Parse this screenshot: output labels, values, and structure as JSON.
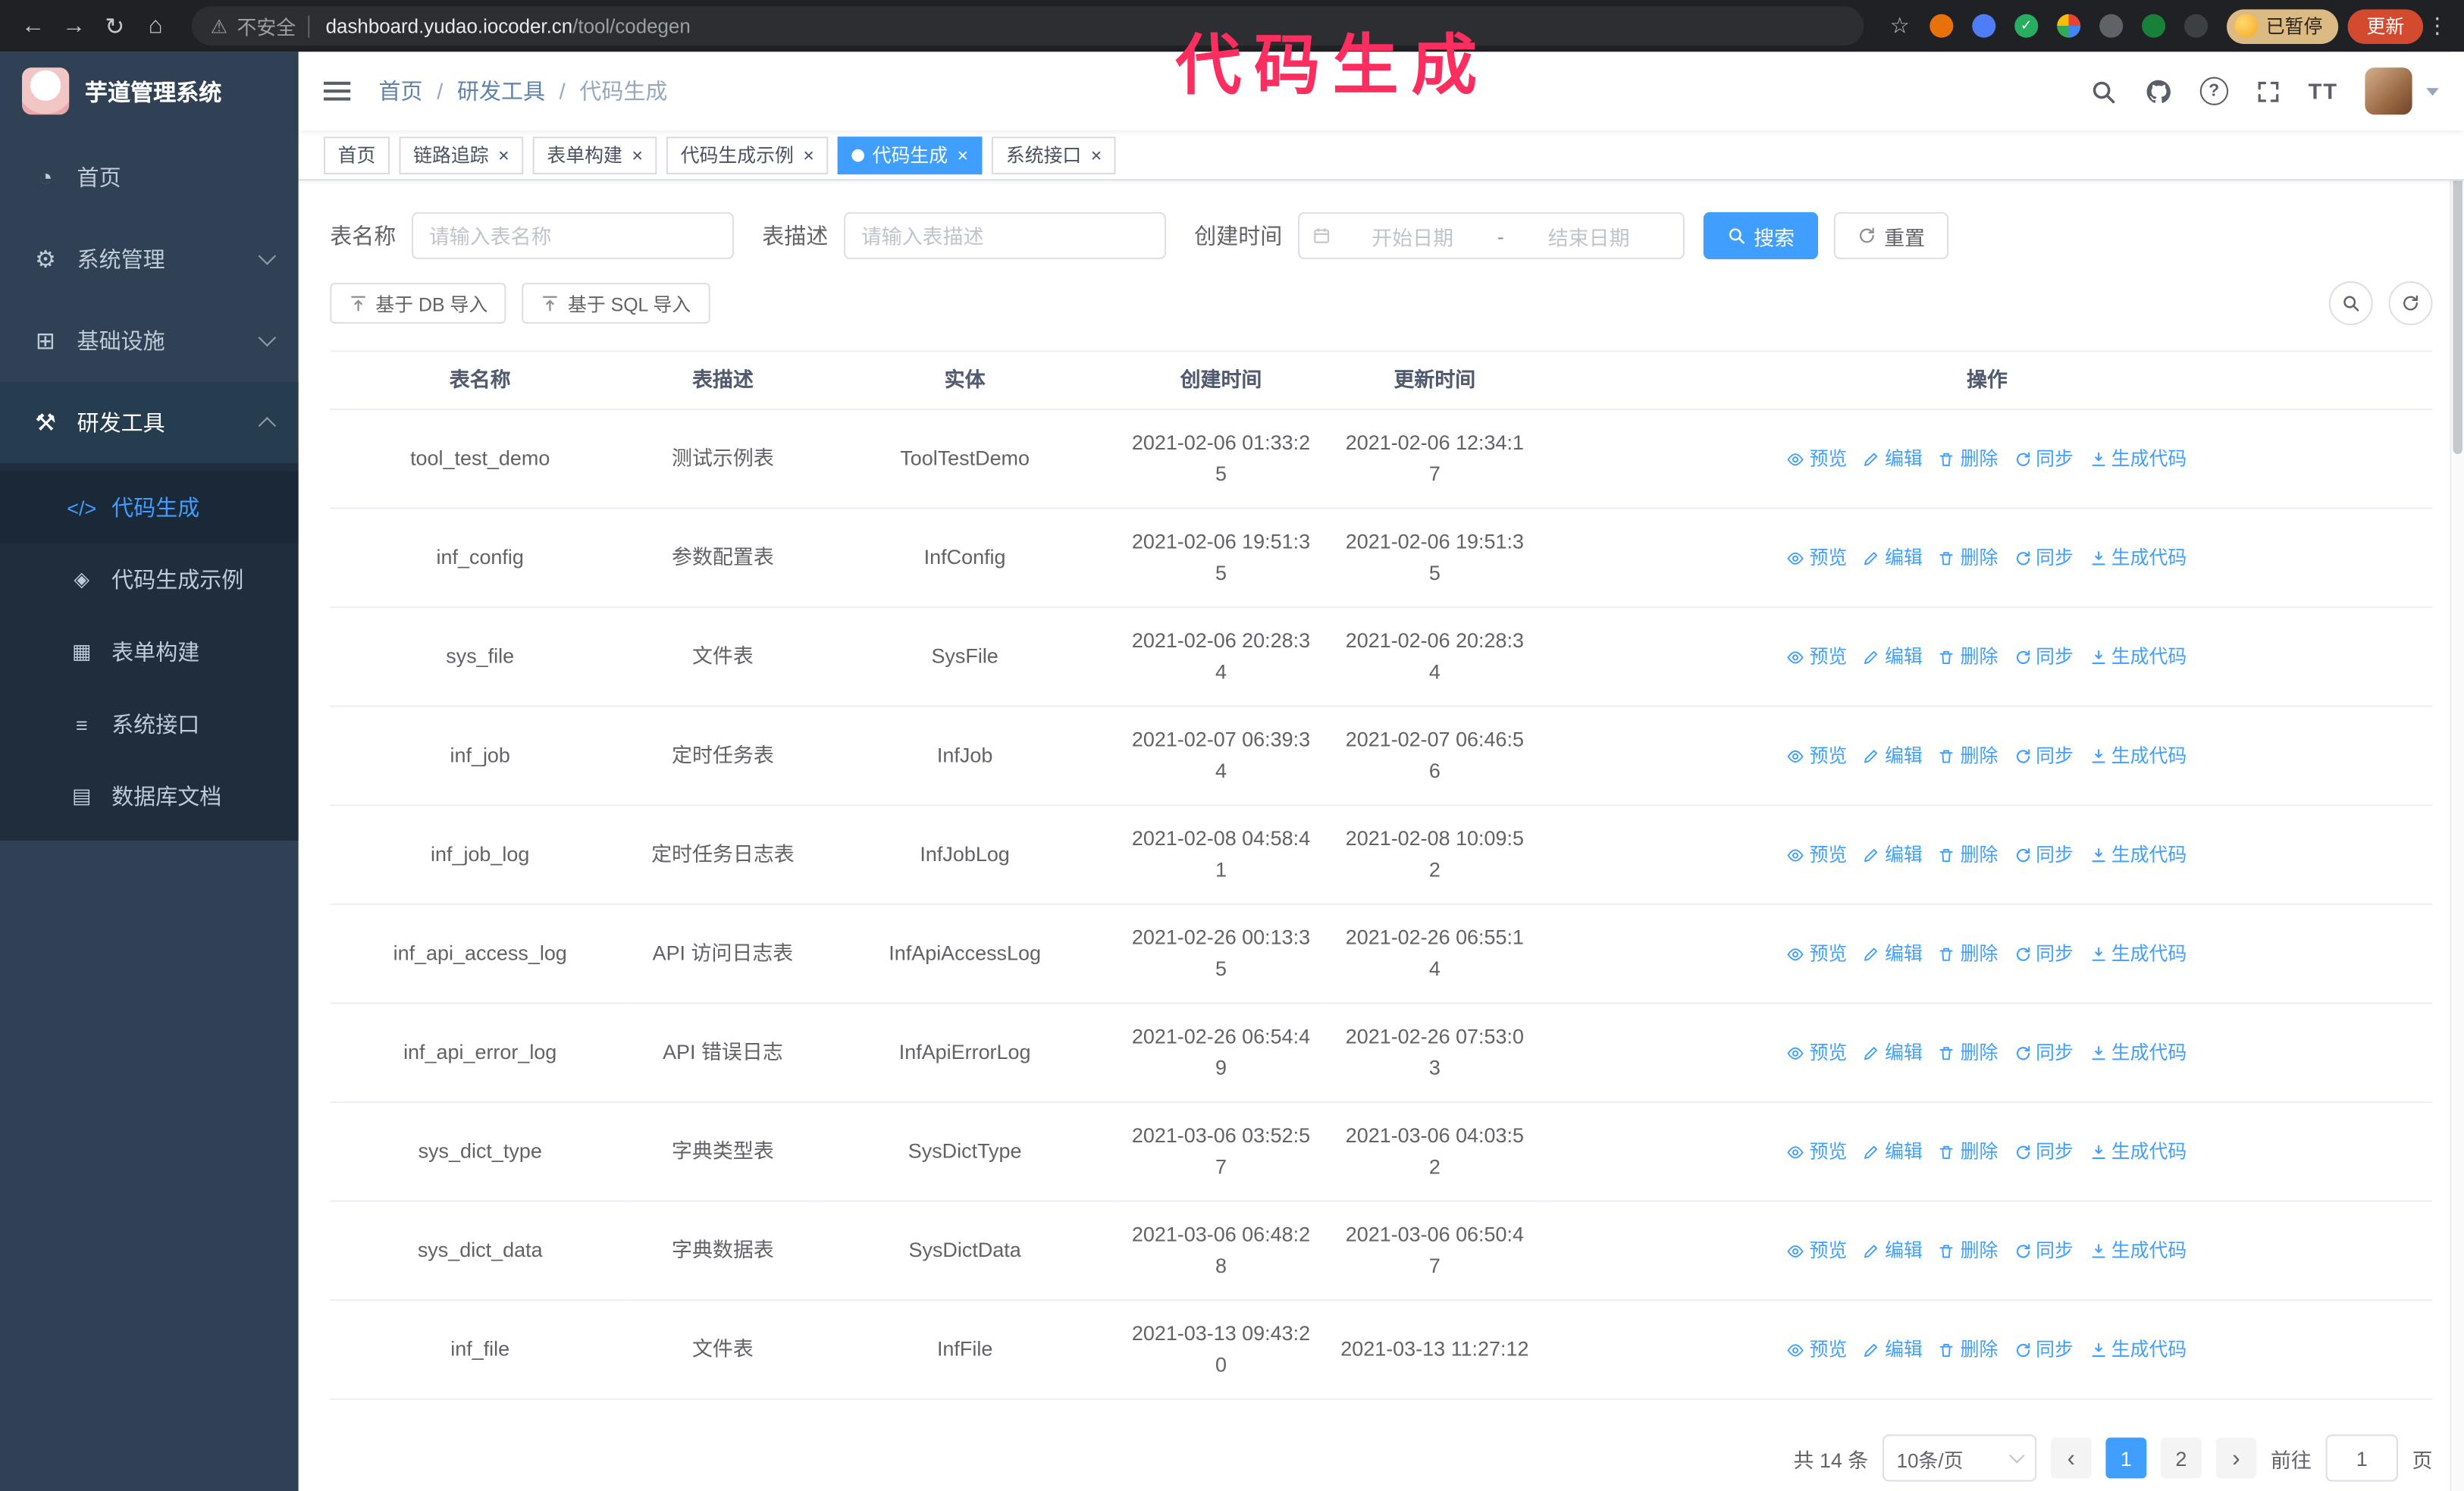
{
  "theme": {
    "accent": "#409eff",
    "sidebar_bg": "#304156",
    "submenu_bg": "#1f2d3d",
    "annotation_color": "#fb2e5f"
  },
  "annotation": {
    "text": "代码生成"
  },
  "browser": {
    "security_label": "不安全",
    "url_host": "dashboard.yudao.iocoder.cn",
    "url_path": "/tool/codegen",
    "paused_badge": "已暂停",
    "update_label": "更新"
  },
  "icon_glyphs": {
    "back": "←",
    "forward": "→",
    "reload": "↻",
    "home": "⌂",
    "warning": "⚠",
    "star": "☆",
    "menu_dots": "⋮",
    "check": "✓",
    "help": "?",
    "font_size": "TT",
    "close": "×",
    "prev": "‹",
    "next": "›",
    "dashboard": "◔",
    "gear": "⚙",
    "infra": "⊞",
    "tools": "⚒",
    "code": "</>",
    "shield": "◈",
    "form": "▦",
    "api": "≡",
    "db": "▤"
  },
  "sidebar": {
    "logo_title": "芋道管理系统",
    "menu": [
      {
        "id": "home",
        "label": "首页",
        "icon": "dashboard",
        "expandable": false,
        "expanded": false
      },
      {
        "id": "system",
        "label": "系统管理",
        "icon": "gear",
        "expandable": true,
        "expanded": false
      },
      {
        "id": "infra",
        "label": "基础设施",
        "icon": "infra",
        "expandable": true,
        "expanded": false
      },
      {
        "id": "devtools",
        "label": "研发工具",
        "icon": "tools",
        "expandable": true,
        "expanded": true,
        "children": [
          {
            "id": "codegen",
            "label": "代码生成",
            "icon": "code",
            "active": true
          },
          {
            "id": "codegen-example",
            "label": "代码生成示例",
            "icon": "shield",
            "active": false
          },
          {
            "id": "form-builder",
            "label": "表单构建",
            "icon": "form",
            "active": false
          },
          {
            "id": "system-api",
            "label": "系统接口",
            "icon": "api",
            "active": false
          },
          {
            "id": "db-doc",
            "label": "数据库文档",
            "icon": "db",
            "active": false
          }
        ]
      }
    ]
  },
  "header": {
    "breadcrumb": [
      "首页",
      "研发工具",
      "代码生成"
    ],
    "separator": "/"
  },
  "tags": [
    {
      "label": "首页",
      "closable": false,
      "active": false
    },
    {
      "label": "链路追踪",
      "closable": true,
      "active": false
    },
    {
      "label": "表单构建",
      "closable": true,
      "active": false
    },
    {
      "label": "代码生成示例",
      "closable": true,
      "active": false
    },
    {
      "label": "代码生成",
      "closable": true,
      "active": true
    },
    {
      "label": "系统接口",
      "closable": true,
      "active": false
    }
  ],
  "search_form": {
    "table_name_label": "表名称",
    "table_name_placeholder": "请输入表名称",
    "table_desc_label": "表描述",
    "table_desc_placeholder": "请输入表描述",
    "create_time_label": "创建时间",
    "date_start_placeholder": "开始日期",
    "date_separator": "-",
    "date_end_placeholder": "结束日期",
    "search_button": "搜索",
    "reset_button": "重置"
  },
  "toolbar": {
    "import_db_button": "基于 DB 导入",
    "import_sql_button": "基于 SQL 导入"
  },
  "table": {
    "columns": [
      "表名称",
      "表描述",
      "实体",
      "创建时间",
      "更新时间",
      "操作"
    ],
    "actions": [
      {
        "name": "preview",
        "label": "预览",
        "icon": "eye-icon"
      },
      {
        "name": "edit",
        "label": "编辑",
        "icon": "edit-icon"
      },
      {
        "name": "delete",
        "label": "删除",
        "icon": "delete-icon"
      },
      {
        "name": "sync",
        "label": "同步",
        "icon": "sync-icon"
      },
      {
        "name": "generate-code",
        "label": "生成代码",
        "icon": "download-icon"
      }
    ],
    "rows": [
      {
        "name": "tool_test_demo",
        "desc": "测试示例表",
        "entity": "ToolTestDemo",
        "created": "2021-02-06 01:33:25",
        "updated": "2021-02-06 12:34:17"
      },
      {
        "name": "inf_config",
        "desc": "参数配置表",
        "entity": "InfConfig",
        "created": "2021-02-06 19:51:35",
        "updated": "2021-02-06 19:51:35"
      },
      {
        "name": "sys_file",
        "desc": "文件表",
        "entity": "SysFile",
        "created": "2021-02-06 20:28:34",
        "updated": "2021-02-06 20:28:34"
      },
      {
        "name": "inf_job",
        "desc": "定时任务表",
        "entity": "InfJob",
        "created": "2021-02-07 06:39:34",
        "updated": "2021-02-07 06:46:56"
      },
      {
        "name": "inf_job_log",
        "desc": "定时任务日志表",
        "entity": "InfJobLog",
        "created": "2021-02-08 04:58:41",
        "updated": "2021-02-08 10:09:52"
      },
      {
        "name": "inf_api_access_log",
        "desc": "API 访问日志表",
        "entity": "InfApiAccessLog",
        "created": "2021-02-26 00:13:35",
        "updated": "2021-02-26 06:55:14"
      },
      {
        "name": "inf_api_error_log",
        "desc": "API 错误日志",
        "entity": "InfApiErrorLog",
        "created": "2021-02-26 06:54:49",
        "updated": "2021-02-26 07:53:03"
      },
      {
        "name": "sys_dict_type",
        "desc": "字典类型表",
        "entity": "SysDictType",
        "created": "2021-03-06 03:52:57",
        "updated": "2021-03-06 04:03:52"
      },
      {
        "name": "sys_dict_data",
        "desc": "字典数据表",
        "entity": "SysDictData",
        "created": "2021-03-06 06:48:28",
        "updated": "2021-03-06 06:50:47"
      },
      {
        "name": "inf_file",
        "desc": "文件表",
        "entity": "InfFile",
        "created": "2021-03-13 09:43:20",
        "updated": "2021-03-13 11:27:12"
      }
    ]
  },
  "pagination": {
    "total": "共 14 条",
    "page_size": "10条/页",
    "pages": [
      {
        "label": "1",
        "active": true
      },
      {
        "label": "2",
        "active": false
      }
    ],
    "goto_prefix": "前往",
    "goto_value": "1",
    "goto_suffix": "页"
  }
}
